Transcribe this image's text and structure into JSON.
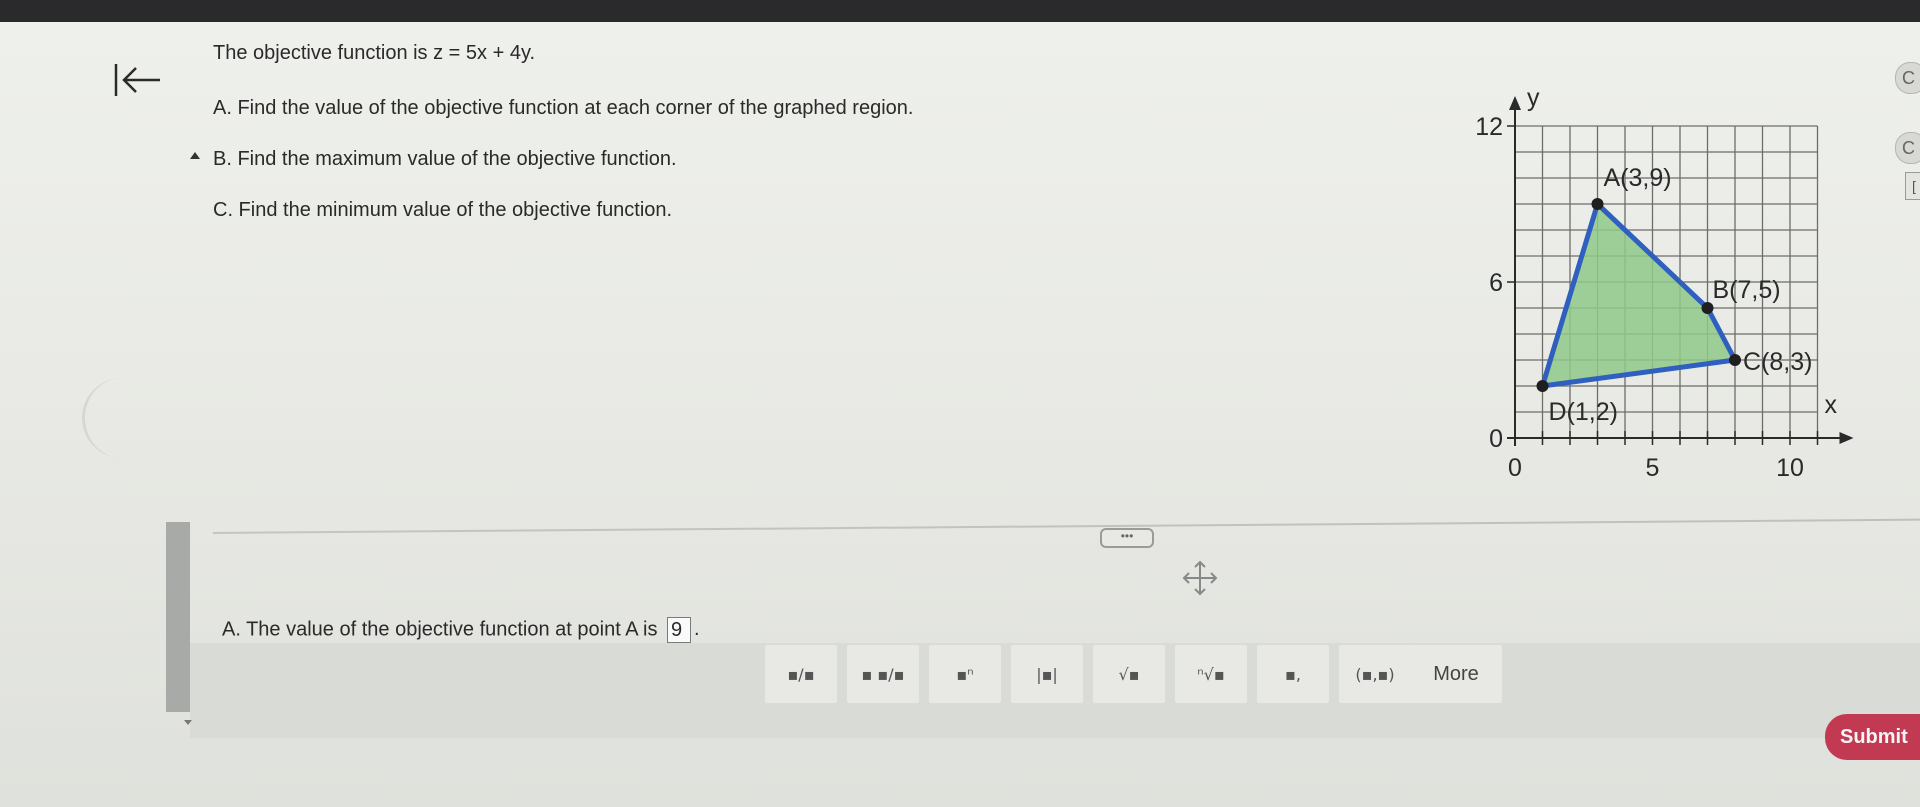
{
  "question": {
    "objective_prefix": "The objective function is ",
    "objective_equation": "z = 5x + 4y.",
    "parts": [
      "A. Find the value of the objective function at each corner of the graphed region.",
      "B. Find the maximum value of the objective function.",
      "C. Find the minimum value of the objective function."
    ]
  },
  "graph": {
    "y_axis_label": "y",
    "x_axis_label": "x",
    "y_tick_labels": [
      "12",
      "6",
      "0"
    ],
    "x_tick_labels": [
      "0",
      "5",
      "10"
    ],
    "x_range": [
      0,
      10
    ],
    "y_range": [
      0,
      12
    ],
    "grid": true,
    "region_fill": "#8fc98a",
    "region_stroke": "#2f5fbf",
    "points": [
      {
        "label": "A(3,9)",
        "x": 3,
        "y": 9
      },
      {
        "label": "B(7,5)",
        "x": 7,
        "y": 5
      },
      {
        "label": "C(8,3)",
        "x": 8,
        "y": 3
      },
      {
        "label": "D(1,2)",
        "x": 1,
        "y": 2
      }
    ]
  },
  "ellipsis_label": "•••",
  "answer": {
    "prefix": "A. The value of the objective function at point A is",
    "value": "9",
    "suffix": "."
  },
  "toolbar": {
    "tools": [
      {
        "icon": "fraction-icon",
        "glyph": "▪/▪"
      },
      {
        "icon": "mixed-number-icon",
        "glyph": "▪ ▪/▪"
      },
      {
        "icon": "exponent-icon",
        "glyph": "▪ⁿ"
      },
      {
        "icon": "absolute-value-icon",
        "glyph": "|▪|"
      },
      {
        "icon": "square-root-icon",
        "glyph": "√▪"
      },
      {
        "icon": "nth-root-icon",
        "glyph": "ⁿ√▪"
      },
      {
        "icon": "decimal-icon",
        "glyph": "▪,"
      },
      {
        "icon": "ordered-pair-icon",
        "glyph": "(▪,▪)"
      }
    ],
    "more_label": "More"
  },
  "submit_label": "Submit",
  "right_controls": [
    "C",
    "C",
    "["
  ],
  "colors": {
    "submit": "#c23a52",
    "accent": "#2f5fbf"
  }
}
